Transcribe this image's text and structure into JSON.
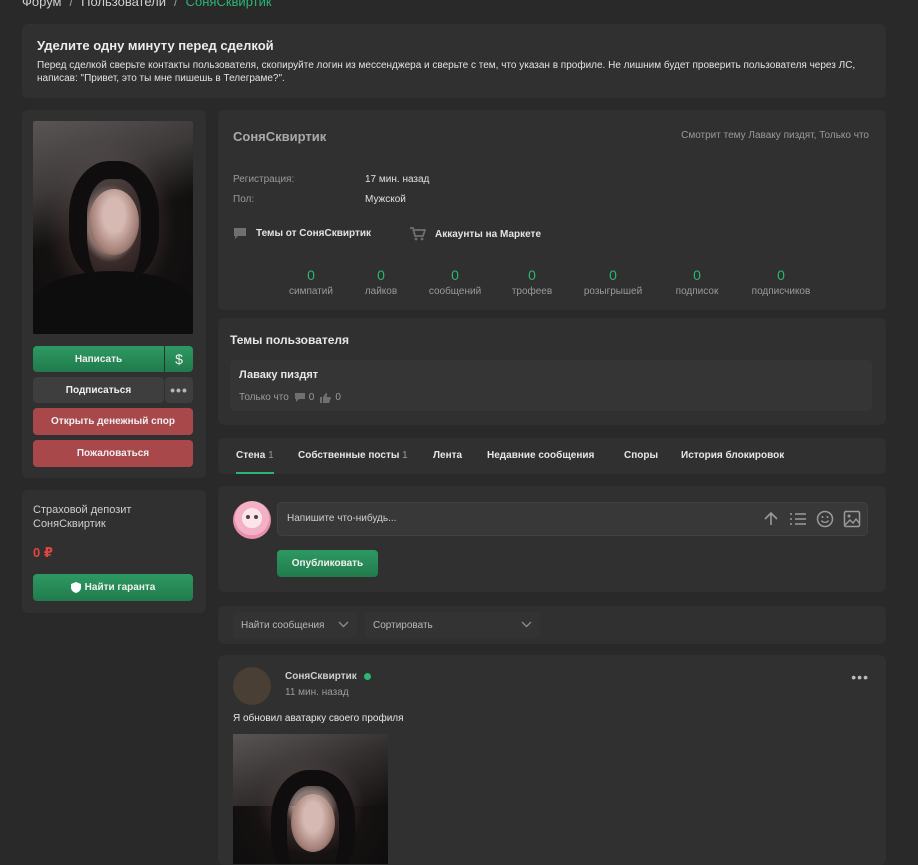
{
  "breadcrumb": {
    "forum": "Форум",
    "users": "Пользователи",
    "current": "СоняСквиртик",
    "sep": "/"
  },
  "notice": {
    "title": "Уделите одну минуту перед сделкой",
    "text": "Перед сделкой сверьте контакты пользователя, скопируйте логин из мессенджера и сверьте с тем, что указан в профиле. Не лишним будет проверить пользователя через ЛС, написав: \"Привет, это ты мне пишешь в Телеграме?\"."
  },
  "sidebar": {
    "write_label": "Написать",
    "money_icon": "$",
    "follow_label": "Подписаться",
    "more_icon": "•••",
    "dispute_label": "Открыть денежный спор",
    "report_label": "Пожаловаться"
  },
  "deposit": {
    "label": "Страховой депозит СоняСквиртик",
    "amount": "0 ₽",
    "guarantor_label": "Найти гаранта"
  },
  "profile": {
    "username": "СоняСквиртик",
    "status": "Смотрит тему Лаваку пиздят, Только что",
    "registration_label": "Регистрация:",
    "registration_value": "17 мин. назад",
    "gender_label": "Пол:",
    "gender_value": "Мужской",
    "topics_link": "Темы от СоняСквиртик",
    "market_link": "Аккаунты на Маркете",
    "stats": [
      {
        "value": "0",
        "label": "симпатий"
      },
      {
        "value": "0",
        "label": "лайков"
      },
      {
        "value": "0",
        "label": "сообщений"
      },
      {
        "value": "0",
        "label": "трофеев"
      },
      {
        "value": "0",
        "label": "розыгрышей"
      },
      {
        "value": "0",
        "label": "подписок"
      },
      {
        "value": "0",
        "label": "подписчиков"
      }
    ]
  },
  "topics": {
    "title": "Темы пользователя",
    "item": {
      "name": "Лаваку пиздят",
      "time": "Только что",
      "replies": "0",
      "likes": "0"
    }
  },
  "tabs": [
    {
      "label": "Стена",
      "count": "1"
    },
    {
      "label": "Собственные посты",
      "count": "1"
    },
    {
      "label": "Лента",
      "count": ""
    },
    {
      "label": "Недавние сообщения",
      "count": ""
    },
    {
      "label": "Споры",
      "count": ""
    },
    {
      "label": "История блокировок",
      "count": ""
    }
  ],
  "composer": {
    "placeholder": "Напишите что-нибудь...",
    "publish_label": "Опубликовать"
  },
  "filters": {
    "search_label": "Найти сообщения",
    "sort_label": "Сортировать"
  },
  "post": {
    "author": "СоняСквиртик",
    "time": "11 мин. назад",
    "menu_icon": "•••",
    "text": "Я обновил аватарку своего профиля"
  },
  "colors": {
    "accent": "#2bb673",
    "danger": "#e64343",
    "background": "#292929",
    "card": "#303030"
  }
}
